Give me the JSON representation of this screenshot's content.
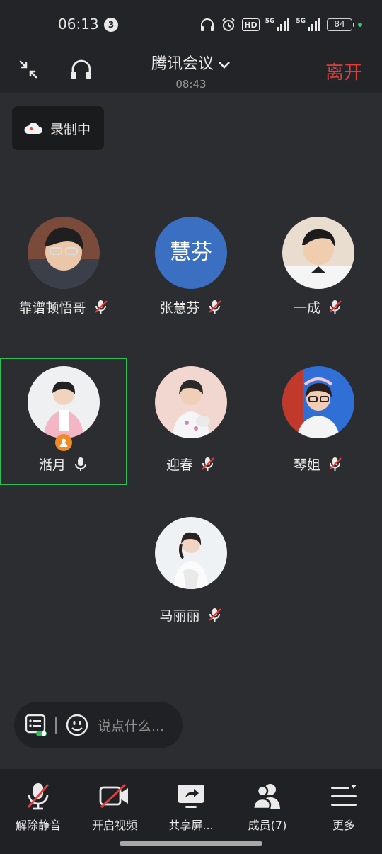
{
  "status_bar": {
    "time": "06:13",
    "notification_count": "3",
    "icons": [
      "headphones-icon",
      "alarm-icon",
      "hd-icon",
      "signal-5g-icon",
      "signal-5g-icon"
    ],
    "hd_label": "HD",
    "net1": "5G",
    "net2": "5G",
    "battery": "84"
  },
  "header": {
    "title": "腾讯会议",
    "duration": "08:43",
    "leave_label": "离开"
  },
  "recording": {
    "label": "录制中"
  },
  "participants": [
    {
      "name": "靠谱顿悟哥",
      "muted": true
    },
    {
      "name": "张慧芬",
      "muted": true,
      "avatar_text": "慧芬"
    },
    {
      "name": "一成",
      "muted": true
    },
    {
      "name": "湉月",
      "muted": false,
      "host": true,
      "active": true
    },
    {
      "name": "迎春",
      "muted": true
    },
    {
      "name": "琴姐",
      "muted": true
    },
    {
      "name": "马丽丽",
      "muted": true
    }
  ],
  "chat": {
    "placeholder": "说点什么..."
  },
  "toolbar": {
    "unmute": "解除静音",
    "video": "开启视频",
    "share": "共享屏...",
    "members": "成员(7)",
    "more": "更多"
  },
  "colors": {
    "accent_leave": "#e53b3b",
    "active_border": "#2fbf5a",
    "host_badge": "#f08a24",
    "text_avatar": "#3b6fc2"
  }
}
